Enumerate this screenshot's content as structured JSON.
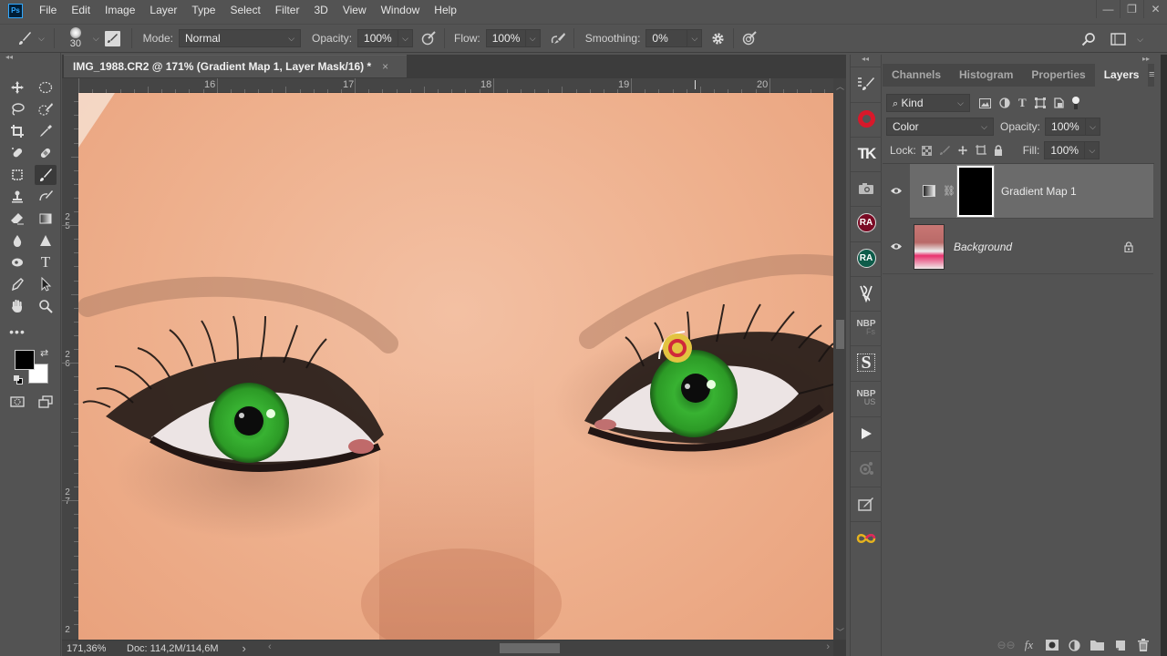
{
  "app": {
    "logo": "Ps"
  },
  "menu": [
    "File",
    "Edit",
    "Image",
    "Layer",
    "Type",
    "Select",
    "Filter",
    "3D",
    "View",
    "Window",
    "Help"
  ],
  "window_controls": {
    "minimize": "—",
    "restore": "❐",
    "close": "✕"
  },
  "options_bar": {
    "brush_size": "30",
    "mode_label": "Mode:",
    "mode_value": "Normal",
    "opacity_label": "Opacity:",
    "opacity_value": "100%",
    "flow_label": "Flow:",
    "flow_value": "100%",
    "smoothing_label": "Smoothing:",
    "smoothing_value": "0%"
  },
  "document": {
    "tab_title": "IMG_1988.CR2 @ 171% (Gradient Map 1, Layer Mask/16) *",
    "close": "×",
    "ruler_top": [
      "16",
      "17",
      "18",
      "19",
      "20"
    ],
    "ruler_left": [
      [
        "2",
        "5"
      ],
      [
        "2",
        "6"
      ],
      [
        "2",
        "7"
      ],
      [
        "2"
      ]
    ],
    "zoom": "171,36%",
    "doc_size": "Doc: 114,2M/114,6M",
    "status_arrow": "›"
  },
  "colors": {
    "foreground": "#000000",
    "background": "#ffffff",
    "accent_blue": "#31a8ff",
    "cursor_outer": "#e3c341",
    "cursor_ring": "#d0283a",
    "iris": "#3fb53a"
  },
  "icon_strip": [
    {
      "name": "brush-presets-icon",
      "label": ""
    },
    {
      "name": "red-ring-plugin-icon",
      "label": ""
    },
    {
      "name": "tk-panel-icon",
      "label": "TK"
    },
    {
      "name": "camera-icon",
      "label": ""
    },
    {
      "name": "ra-red-icon",
      "label": "RA"
    },
    {
      "name": "ra-green-icon",
      "label": "RA"
    },
    {
      "name": "vs-plugin-icon",
      "label": ""
    },
    {
      "name": "nbp-fs-icon",
      "label": "NBP",
      "sub": "Fs"
    },
    {
      "name": "s-plugin-icon",
      "label": "S"
    },
    {
      "name": "nbp-us-icon",
      "label": "NBP",
      "sub": "US"
    },
    {
      "name": "play-icon",
      "label": ""
    },
    {
      "name": "share-plugin-icon",
      "label": ""
    },
    {
      "name": "edit-plugin-icon",
      "label": ""
    },
    {
      "name": "infinity-plugin-icon",
      "label": ""
    }
  ],
  "layers_panel": {
    "tabs": [
      "Channels",
      "Histogram",
      "Properties",
      "Layers"
    ],
    "active_tab": "Layers",
    "filter_kind": "Kind",
    "blend_mode": "Color",
    "opacity_label": "Opacity:",
    "opacity_value": "100%",
    "lock_label": "Lock:",
    "fill_label": "Fill:",
    "fill_value": "100%",
    "layers": [
      {
        "name": "Gradient Map 1",
        "visible": true,
        "selected": true,
        "type": "adjustment-with-mask"
      },
      {
        "name": "Background",
        "visible": true,
        "selected": false,
        "locked": true,
        "italic": true
      }
    ]
  }
}
